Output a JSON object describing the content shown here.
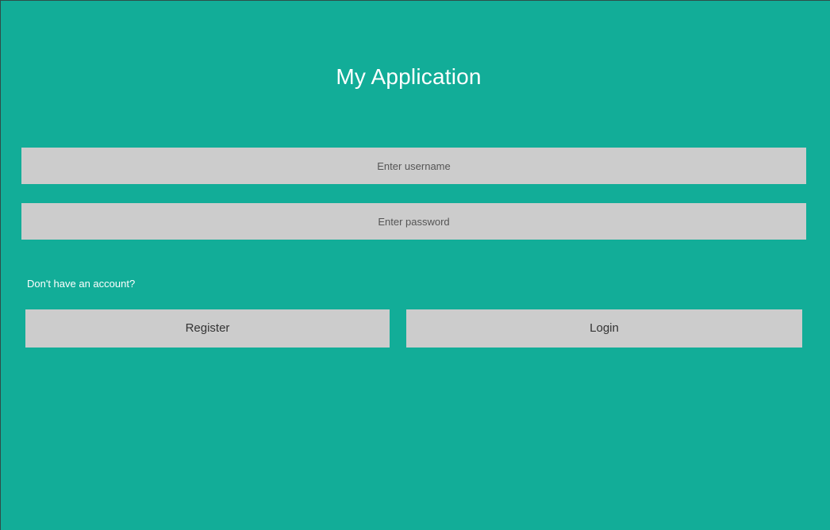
{
  "app": {
    "title": "My Application"
  },
  "form": {
    "username": {
      "placeholder": "Enter username",
      "value": ""
    },
    "password": {
      "placeholder": "Enter password",
      "value": ""
    },
    "hint": "Don't have an account?",
    "register_label": "Register",
    "login_label": "Login"
  },
  "colors": {
    "background": "#12ad98",
    "field_background": "#cccccc",
    "text_light": "#ffffff",
    "text_dark": "#333333"
  }
}
